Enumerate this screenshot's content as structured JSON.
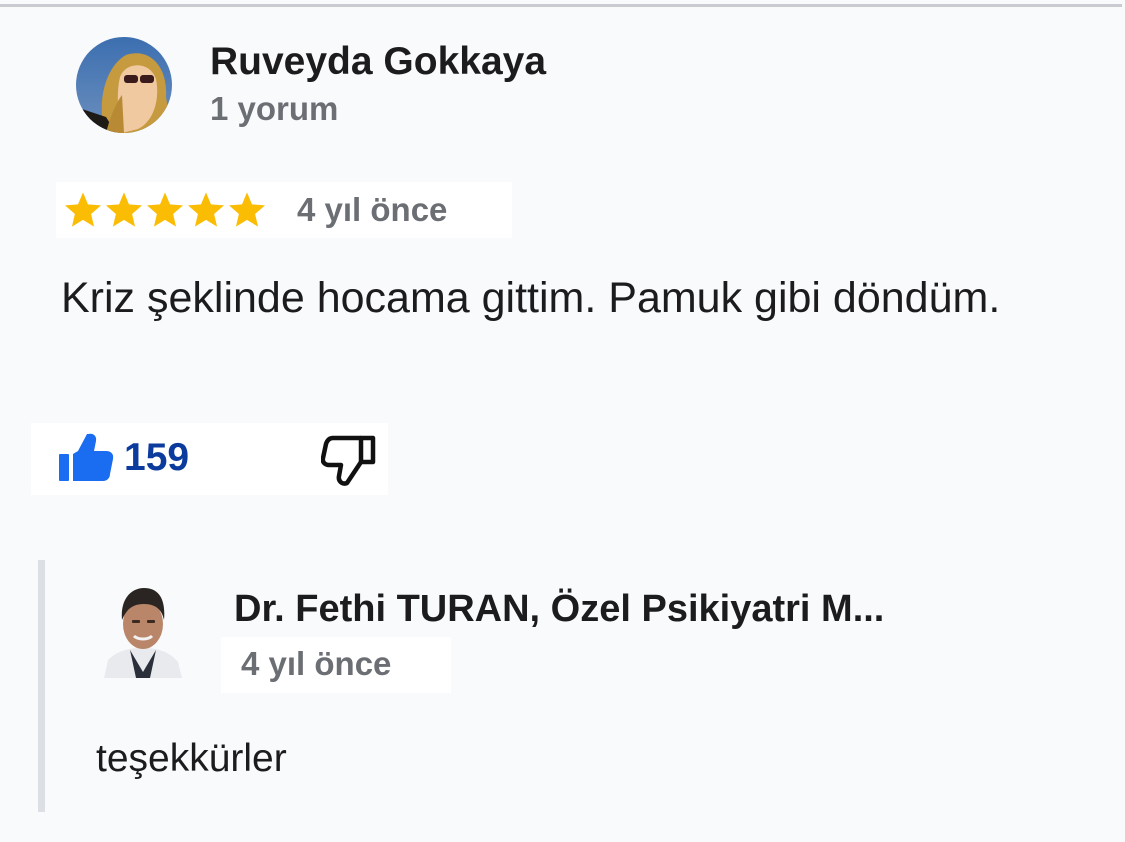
{
  "review": {
    "author_name": "Ruveyda Gokkaya",
    "author_meta": "1 yorum",
    "avatar_icon": "user-photo-avatar",
    "rating": 5,
    "rating_max": 5,
    "star_color": "#fbbc04",
    "time": "4 yıl önce",
    "text": "Kriz şeklinde hocama gittim. Pamuk gibi döndüm.",
    "like_count": "159",
    "like_icon": "thumb-up-icon",
    "dislike_icon": "thumb-down-icon",
    "like_color": "#0b3b9c"
  },
  "reply": {
    "author_name": "Dr. Fethi TURAN, Özel Psikiyatri M...",
    "avatar_icon": "doctor-photo-avatar",
    "time": "4 yıl önce",
    "text": "teşekkürler"
  }
}
